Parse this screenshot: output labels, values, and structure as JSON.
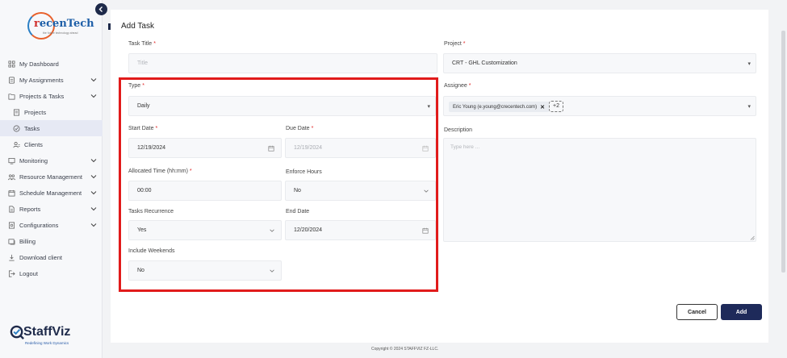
{
  "sidebar": {
    "logo_text_prefix": "r",
    "logo_text_main": "ecenTech",
    "logo_tagline": "the future technology ahead",
    "items": [
      {
        "label": "My Dashboard",
        "icon": "dashboard-icon",
        "expandable": false,
        "active": false
      },
      {
        "label": "My Assignments",
        "icon": "assignments-icon",
        "expandable": true,
        "active": false
      },
      {
        "label": "Projects & Tasks",
        "icon": "projects-tasks-icon",
        "expandable": true,
        "active": false
      },
      {
        "label": "Projects",
        "icon": "projects-icon",
        "expandable": false,
        "active": false
      },
      {
        "label": "Tasks",
        "icon": "tasks-icon",
        "expandable": false,
        "active": true
      },
      {
        "label": "Clients",
        "icon": "clients-icon",
        "expandable": false,
        "active": false
      },
      {
        "label": "Monitoring",
        "icon": "monitoring-icon",
        "expandable": true,
        "active": false
      },
      {
        "label": "Resource Management",
        "icon": "resource-icon",
        "expandable": true,
        "active": false
      },
      {
        "label": "Schedule Management",
        "icon": "schedule-icon",
        "expandable": true,
        "active": false
      },
      {
        "label": "Reports",
        "icon": "reports-icon",
        "expandable": true,
        "active": false
      },
      {
        "label": "Configurations",
        "icon": "configurations-icon",
        "expandable": true,
        "active": false
      },
      {
        "label": "Billing",
        "icon": "billing-icon",
        "expandable": false,
        "active": false
      },
      {
        "label": "Download client",
        "icon": "download-icon",
        "expandable": false,
        "active": false
      },
      {
        "label": "Logout",
        "icon": "logout-icon",
        "expandable": false,
        "active": false
      }
    ],
    "brand_name": "StaffViz",
    "brand_tagline": "Redefining Work Dynamics"
  },
  "page": {
    "title": "Add Task"
  },
  "form": {
    "task_title": {
      "label": "Task Title",
      "placeholder": "Title"
    },
    "project": {
      "label": "Project",
      "value": "CRT - GHL Customization"
    },
    "type": {
      "label": "Type",
      "value": "Daily"
    },
    "assignee": {
      "label": "Assignee",
      "chip": "Eric Young (e.young@crecentech.com)",
      "more": "+2"
    },
    "start_date": {
      "label": "Start Date",
      "value": "12/19/2024"
    },
    "due_date": {
      "label": "Due Date",
      "value": "12/19/2024"
    },
    "description": {
      "label": "Description",
      "placeholder": "Type here ..."
    },
    "allocated_time": {
      "label": "Allocated Time (hh:mm)",
      "value": "00:00"
    },
    "enforce_hours": {
      "label": "Enforce Hours",
      "value": "No"
    },
    "tasks_recurrence": {
      "label": "Tasks Recurrence",
      "value": "Yes"
    },
    "end_date": {
      "label": "End Date",
      "value": "12/20/2024"
    },
    "include_weekends": {
      "label": "Include Weekends",
      "value": "No"
    },
    "required_mark": "*"
  },
  "actions": {
    "cancel_label": "Cancel",
    "add_label": "Add"
  },
  "footer": {
    "copyright": "Copyright © 2024 STAFFVIZ FZ-LLC."
  },
  "colors": {
    "highlight": "#e11b1b",
    "primary": "#1e2a5a",
    "required": "#e02424"
  }
}
